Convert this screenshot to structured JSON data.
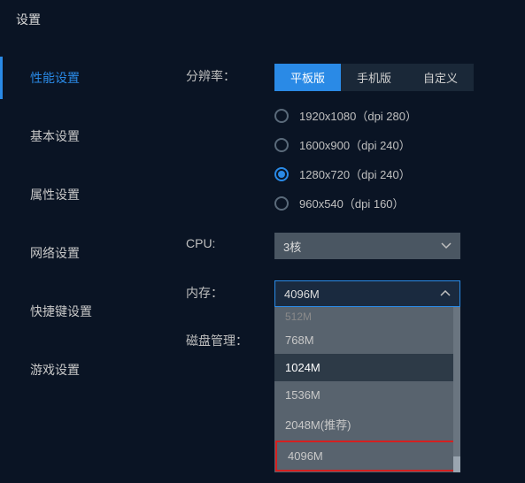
{
  "window": {
    "title": "设置"
  },
  "sidebar": {
    "items": [
      {
        "label": "性能设置",
        "active": true
      },
      {
        "label": "基本设置",
        "active": false
      },
      {
        "label": "属性设置",
        "active": false
      },
      {
        "label": "网络设置",
        "active": false
      },
      {
        "label": "快捷键设置",
        "active": false
      },
      {
        "label": "游戏设置",
        "active": false
      }
    ]
  },
  "labels": {
    "resolution": "分辨率：",
    "cpu": "CPU:",
    "memory": "内存：",
    "disk": "磁盘管理："
  },
  "resolution": {
    "tabs": [
      {
        "label": "平板版",
        "active": true
      },
      {
        "label": "手机版",
        "active": false
      },
      {
        "label": "自定义",
        "active": false
      }
    ],
    "options": [
      {
        "label": "1920x1080（dpi 280）",
        "selected": false
      },
      {
        "label": "1600x900（dpi 240）",
        "selected": false
      },
      {
        "label": "1280x720（dpi 240）",
        "selected": true
      },
      {
        "label": "960x540（dpi 160）",
        "selected": false
      }
    ]
  },
  "cpu": {
    "selected": "3核"
  },
  "memory": {
    "selected": "4096M",
    "options": [
      {
        "label": "512M",
        "tight": true
      },
      {
        "label": "768M"
      },
      {
        "label": "1024M",
        "highlighted": true
      },
      {
        "label": "1536M"
      },
      {
        "label": "2048M(推荐)"
      },
      {
        "label": "4096M",
        "redbox": true
      }
    ]
  }
}
